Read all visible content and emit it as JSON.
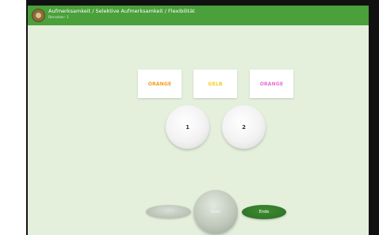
{
  "appbar": {
    "title": "Aufmerksamkeit / Selektive Aufmerksamkeit / Flexibilität",
    "subtitle": "Benutzer: 1",
    "color": "#4aa03a"
  },
  "cards": [
    {
      "label": "ORANGE",
      "color": "#f39a1b"
    },
    {
      "label": "GELB",
      "color": "#f3d01b"
    },
    {
      "label": "ORANGE",
      "color": "#e86bd6"
    }
  ],
  "answers": [
    {
      "label": "1"
    },
    {
      "label": "2"
    }
  ],
  "controls": {
    "start_label": "Start",
    "end_label": "Ende"
  }
}
